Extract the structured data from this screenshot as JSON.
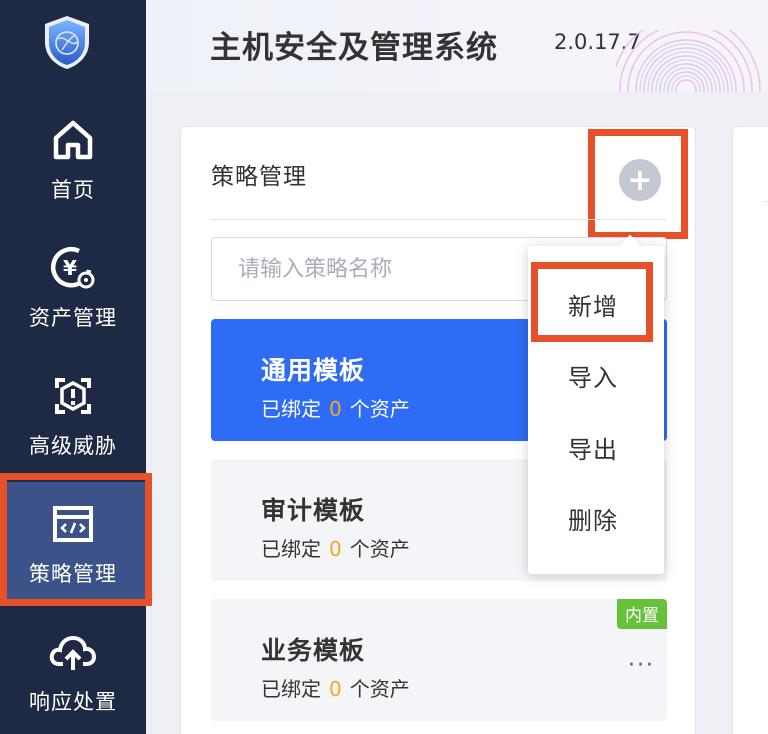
{
  "app": {
    "title": "主机安全及管理系统",
    "version": "2.0.17.7"
  },
  "sidebar": {
    "items": [
      {
        "label": "首页",
        "icon": "home-icon"
      },
      {
        "label": "资产管理",
        "icon": "asset-icon"
      },
      {
        "label": "高级威胁",
        "icon": "threat-icon"
      },
      {
        "label": "策略管理",
        "icon": "policy-icon",
        "active": true
      },
      {
        "label": "响应处置",
        "icon": "cloud-upload-icon"
      }
    ]
  },
  "panel": {
    "title": "策略管理",
    "search_placeholder": "请输入策略名称",
    "bound_prefix": "已绑定",
    "bound_suffix": "个资产",
    "cards": [
      {
        "name": "通用模板",
        "count": "0",
        "active": true
      },
      {
        "name": "审计模板",
        "count": "0"
      },
      {
        "name": "业务模板",
        "count": "0",
        "badge": "内置",
        "more": "···"
      }
    ]
  },
  "dropdown": {
    "items": [
      "新增",
      "导入",
      "导出",
      "删除"
    ]
  },
  "colors": {
    "sidebar_bg": "#1e2a44",
    "sidebar_active": "#3b5389",
    "primary": "#2e6cf6",
    "highlight": "#e8502a",
    "count": "#f5a623",
    "badge": "#67c23a"
  }
}
